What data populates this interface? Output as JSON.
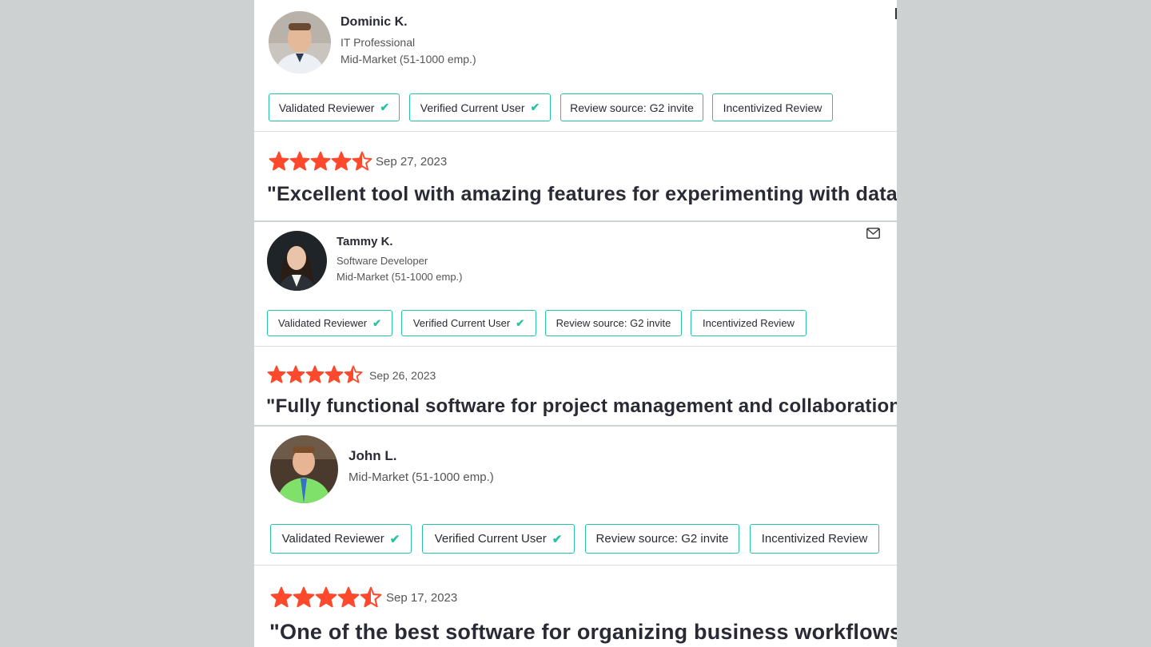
{
  "reviews": [
    {
      "reviewer": {
        "name": "Dominic K.",
        "role": "IT Professional",
        "segment": "Mid-Market (51-1000 emp.)"
      },
      "badges": [
        {
          "label": "Validated Reviewer",
          "check": "✔"
        },
        {
          "label": "Verified Current User",
          "check": "✔"
        },
        {
          "label": "Review source: G2 invite",
          "check": ""
        },
        {
          "label": "Incentivized Review",
          "check": ""
        }
      ],
      "rating": 4.5,
      "date": "Sep 27, 2023",
      "title": "\"Excellent tool with amazing features for experimenting with data.\""
    },
    {
      "reviewer": {
        "name": "Tammy K.",
        "role": "Software Developer",
        "segment": "Mid-Market (51-1000 emp.)"
      },
      "badges": [
        {
          "label": "Validated Reviewer",
          "check": "✔"
        },
        {
          "label": "Verified Current User",
          "check": "✔"
        },
        {
          "label": "Review source: G2 invite",
          "check": ""
        },
        {
          "label": "Incentivized Review",
          "check": ""
        }
      ],
      "rating": 4.5,
      "date": "Sep 26, 2023",
      "title": "\"Fully functional software for project management and collaboration.\""
    },
    {
      "reviewer": {
        "name": "John L.",
        "role": "",
        "segment": "Mid-Market (51-1000 emp.)"
      },
      "badges": [
        {
          "label": "Validated Reviewer",
          "check": "✔"
        },
        {
          "label": "Verified Current User",
          "check": "✔"
        },
        {
          "label": "Review source: G2 invite",
          "check": ""
        },
        {
          "label": "Incentivized Review",
          "check": ""
        }
      ],
      "rating": 4.5,
      "date": "Sep 17, 2023",
      "title": "\"One of the best software for organizing business workflows.\""
    }
  ],
  "icons": {
    "mail": "mail-icon",
    "star": "star-icon",
    "check": "check-icon"
  },
  "colors": {
    "star": "#ff492c",
    "badge_border": "#27c2a4",
    "check": "#27c2a4",
    "page_bg": "#cdd1d1"
  }
}
